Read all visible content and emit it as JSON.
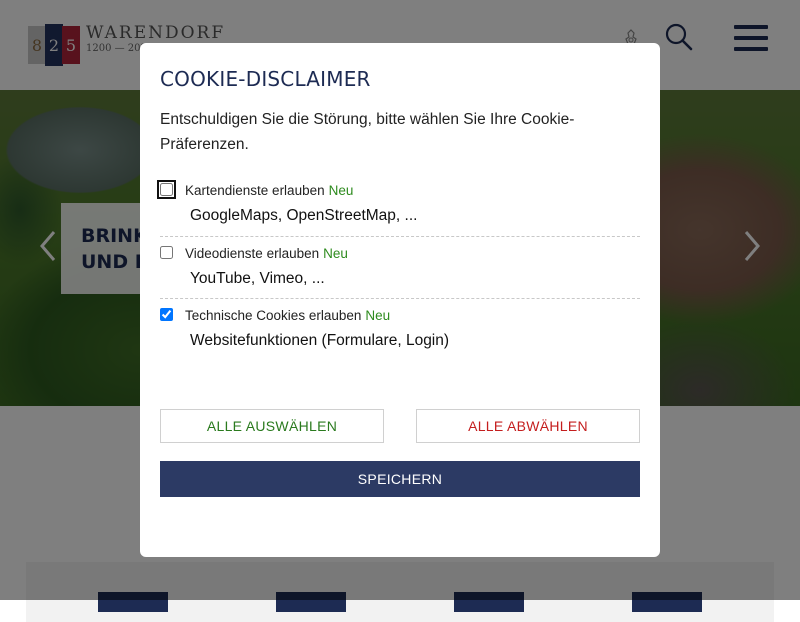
{
  "header": {
    "logo_title": "WARENDORF",
    "logo_subtitle": "1200 — 2025",
    "logo_digits": [
      "8",
      "2",
      "5"
    ]
  },
  "hero": {
    "caption": "BRINK\nUND F"
  },
  "cookie_modal": {
    "title": "COOKIE-DISCLAIMER",
    "intro": "Entschuldigen Sie die Störung, bitte wählen Sie Ihre Cookie-Präferenzen.",
    "options": [
      {
        "label": "Kartendienste erlauben",
        "badge": "Neu",
        "description": "GoogleMaps, OpenStreetMap, ...",
        "checked": false
      },
      {
        "label": "Videodienste erlauben",
        "badge": "Neu",
        "description": "YouTube, Vimeo, ...",
        "checked": false
      },
      {
        "label": "Technische Cookies erlauben",
        "badge": "Neu",
        "description": "Websitefunktionen (Formulare, Login)",
        "checked": true
      }
    ],
    "buttons": {
      "select_all": "ALLE AUSWÄHLEN",
      "deselect_all": "ALLE ABWÄHLEN",
      "save": "SPEICHERN"
    }
  },
  "colors": {
    "brand_navy": "#1d2b53",
    "accept_green": "#2a7a1e",
    "deselect_red": "#c41e1e",
    "badge_green": "#2e8b1e",
    "save_button": "#2c3a64"
  },
  "icons": {
    "crest": "crest-icon",
    "search": "search-icon",
    "menu": "hamburger-menu-icon",
    "prev": "chevron-left-icon",
    "next": "chevron-right-icon"
  }
}
